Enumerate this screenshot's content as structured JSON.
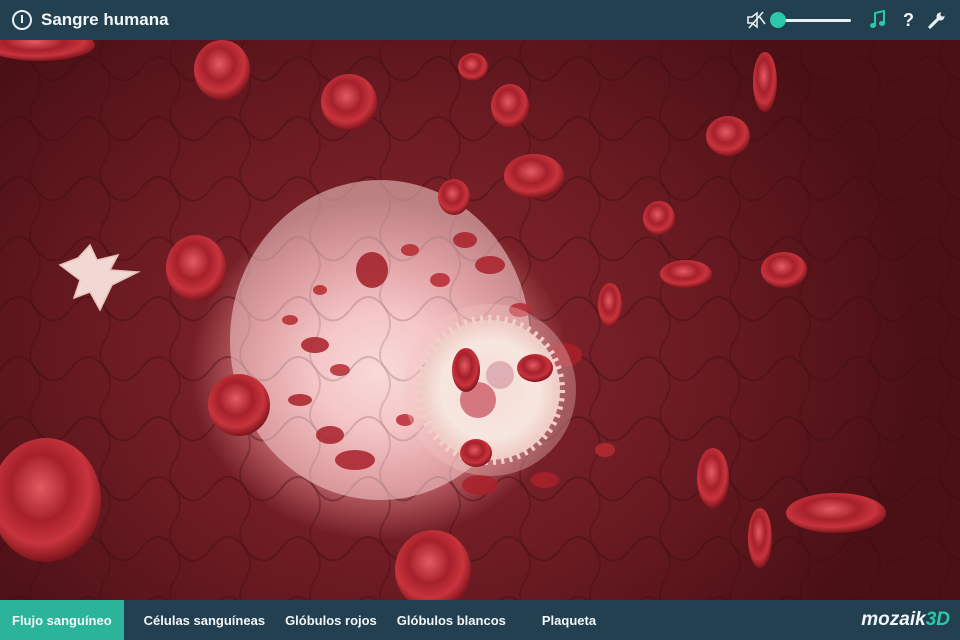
{
  "app": {
    "title": "Sangre humana"
  },
  "audio": {
    "volume_percent": 0
  },
  "help": {
    "label": "?"
  },
  "tabs": [
    {
      "label": "Flujo sanguíneo",
      "active": true
    },
    {
      "label": "Células sanguíneas",
      "active": false
    },
    {
      "label": "Glóbulos rojos",
      "active": false
    },
    {
      "label": "Glóbulos blancos",
      "active": false
    },
    {
      "label": "Plaqueta",
      "active": false
    }
  ],
  "brand": {
    "name": "mozaik",
    "accent": "3D"
  },
  "icons": {
    "power": "power-icon",
    "mute": "speaker-muted-icon",
    "music": "music-note-icon",
    "help": "question-icon",
    "settings": "wrench-icon"
  },
  "colors": {
    "bar": "#22404f",
    "accent": "#2bc9a9",
    "active_tab": "#2bb49a",
    "text": "#f2f6f8"
  }
}
